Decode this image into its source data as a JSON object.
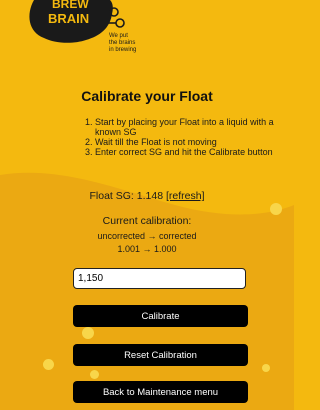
{
  "logo": {
    "text_top": "BREW",
    "text_bottom": "BRAIN",
    "tagline": [
      "We put",
      "the brains",
      "in brewing"
    ]
  },
  "page": {
    "title": "Calibrate your Float",
    "steps": [
      "Start by placing your Float into a liquid with a known SG",
      "Wait till the Float is not moving",
      "Enter correct SG and hit the Calibrate button"
    ]
  },
  "float_sg": {
    "label": "Float SG: 1.148",
    "refresh_link": "[refresh]"
  },
  "calibration": {
    "heading": "Current calibration:",
    "columns": "uncorrected → corrected",
    "values": "1.001 → 1.000"
  },
  "form": {
    "sg_value": "1,150"
  },
  "buttons": {
    "calibrate": "Calibrate",
    "reset": "Reset Calibration",
    "back": "Back to Maintenance menu"
  },
  "colors": {
    "background": "#f4b90f",
    "wave": "#eba912",
    "button": "#000000"
  }
}
